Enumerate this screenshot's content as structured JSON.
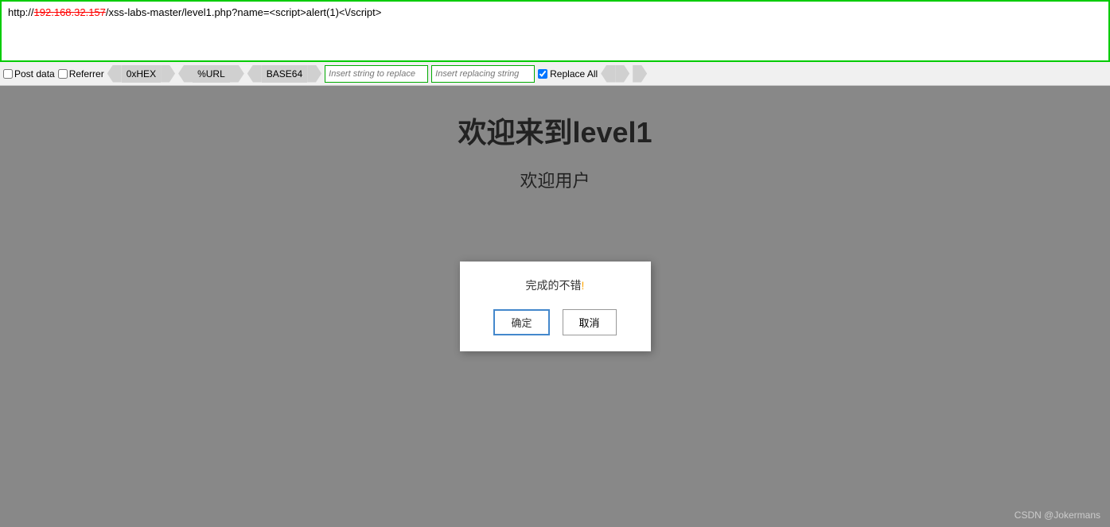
{
  "urlbar": {
    "prefix": "http://",
    "ip_red": "192.168.32.157",
    "suffix": "/xss-labs-master/level1.php?name=<script>alert(1)<\\/script>"
  },
  "toolbar": {
    "post_data_label": "Post data",
    "referrer_label": "Referrer",
    "hex_label": "0xHEX",
    "url_label": "%URL",
    "base64_label": "BASE64",
    "insert_replace_placeholder": "Insert string to replace",
    "insert_replacing_placeholder": "Insert replacing string",
    "replace_all_label": "Replace All"
  },
  "main": {
    "title": "欢迎来到level1",
    "subtitle": "欢迎用户"
  },
  "dialog": {
    "message": "完成的不错",
    "exclaim": "!",
    "ok_label": "确定",
    "cancel_label": "取消"
  },
  "watermark": "CSDN @Jokermans"
}
